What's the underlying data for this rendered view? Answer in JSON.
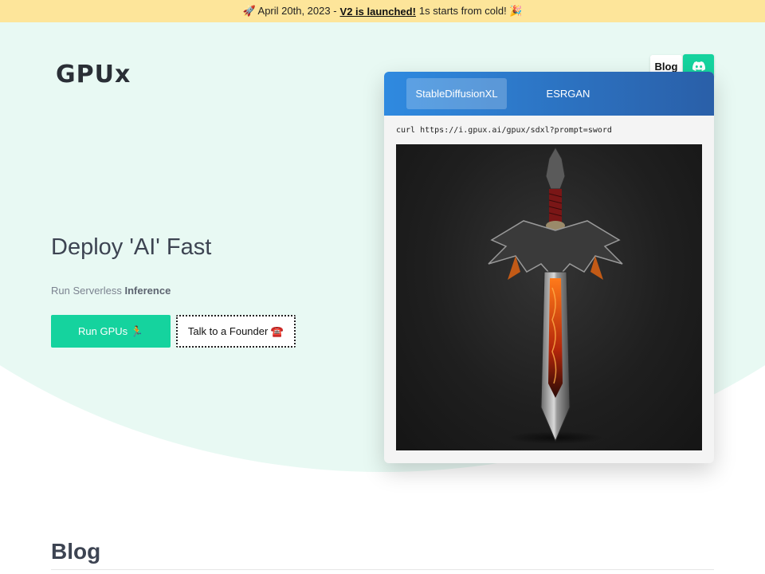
{
  "announcement": {
    "prefix": "🚀 April 20th, 2023 -",
    "link": "V2 is launched!",
    "suffix": "1s starts from cold! 🎉"
  },
  "header": {
    "logo": "GPUx",
    "blog_label": "Blog",
    "discord_icon": "discord-icon"
  },
  "hero": {
    "title": "Deploy 'AI' Fast",
    "subtitle_prefix": "Run Serverless",
    "subtitle_bold": "Inference",
    "primary_cta": "Run GPUs 🏃",
    "secondary_cta": "Talk to a Founder ☎️"
  },
  "demo": {
    "tabs": [
      {
        "label": "StableDiffusionXL",
        "active": true
      },
      {
        "label": "ESRGAN",
        "active": false
      }
    ],
    "command": "curl https://i.gpux.ai/gpux/sdxl?prompt=sword",
    "image_subject": "sword"
  },
  "blog": {
    "heading": "Blog"
  },
  "colors": {
    "announcement_bg": "#fde59a",
    "hero_bg": "#e8f9f3",
    "accent": "#15d39e",
    "tabs_gradient_start": "#2f8ae0",
    "tabs_gradient_end": "#2a5fa8"
  }
}
